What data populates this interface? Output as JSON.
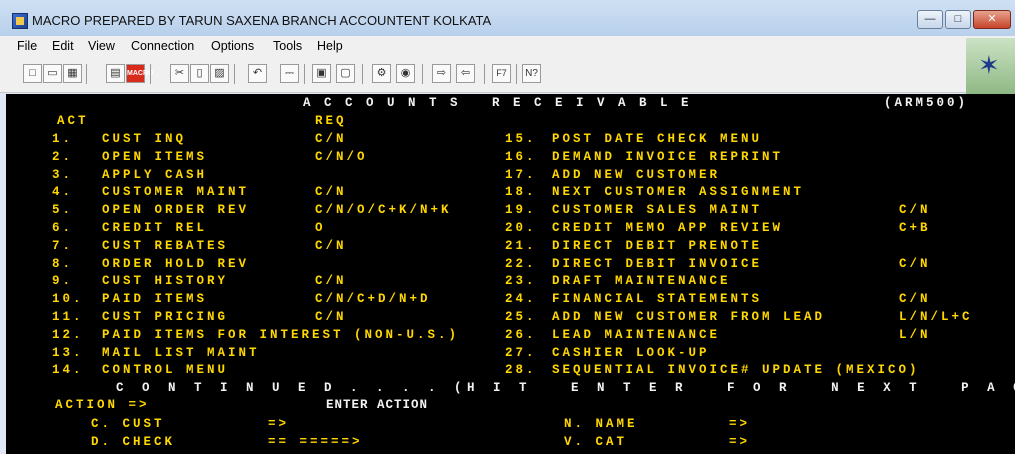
{
  "window": {
    "title": "MACRO PREPARED BY TARUN SAXENA BRANCH ACCOUNTENT KOLKATA"
  },
  "menu": [
    "File",
    "Edit",
    "View",
    "Connection",
    "Options",
    "Tools",
    "Help"
  ],
  "toolbar": {
    "items": [
      "new",
      "open",
      "save",
      "print",
      "macro",
      "cut",
      "copy",
      "paste",
      "undo",
      "transfer",
      "connect",
      "disconnect",
      "settings",
      "palette",
      "send",
      "receive",
      "F7",
      "help"
    ],
    "macro_label": "MACRO",
    "f7_label": "F7",
    "help_label": "N?"
  },
  "screen": {
    "header_title": "A C C O U N T S   R E C E I V A B L E",
    "program_code": "(ARM500)",
    "col_act": "ACT",
    "col_req": "REQ",
    "left_items": [
      {
        "num": "1.",
        "label": "CUST INQ",
        "req": "C/N"
      },
      {
        "num": "2.",
        "label": "OPEN ITEMS",
        "req": "C/N/O"
      },
      {
        "num": "3.",
        "label": "APPLY CASH",
        "req": ""
      },
      {
        "num": "4.",
        "label": "CUSTOMER MAINT",
        "req": "C/N"
      },
      {
        "num": "5.",
        "label": "OPEN ORDER REV",
        "req": "C/N/O/C+K/N+K"
      },
      {
        "num": "6.",
        "label": "CREDIT REL",
        "req": "O"
      },
      {
        "num": "7.",
        "label": "CUST REBATES",
        "req": "C/N"
      },
      {
        "num": "8.",
        "label": "ORDER HOLD REV",
        "req": ""
      },
      {
        "num": "9.",
        "label": "CUST HISTORY",
        "req": "C/N"
      },
      {
        "num": "10.",
        "label": "PAID ITEMS",
        "req": "C/N/C+D/N+D"
      },
      {
        "num": "11.",
        "label": "CUST PRICING",
        "req": "C/N"
      },
      {
        "num": "12.",
        "label": "PAID ITEMS FOR INTEREST (NON-U.S.)",
        "req": ""
      },
      {
        "num": "13.",
        "label": "MAIL LIST MAINT",
        "req": ""
      },
      {
        "num": "14.",
        "label": "CONTROL MENU",
        "req": ""
      }
    ],
    "right_items": [
      {
        "num": "15.",
        "label": "POST DATE CHECK MENU",
        "req": ""
      },
      {
        "num": "16.",
        "label": "DEMAND INVOICE REPRINT",
        "req": ""
      },
      {
        "num": "17.",
        "label": "ADD NEW CUSTOMER",
        "req": ""
      },
      {
        "num": "18.",
        "label": "NEXT CUSTOMER ASSIGNMENT",
        "req": ""
      },
      {
        "num": "19.",
        "label": "CUSTOMER SALES MAINT",
        "req": "C/N"
      },
      {
        "num": "20.",
        "label": "CREDIT MEMO APP REVIEW",
        "req": "C+B"
      },
      {
        "num": "21.",
        "label": "DIRECT DEBIT PRENOTE",
        "req": ""
      },
      {
        "num": "22.",
        "label": "DIRECT DEBIT INVOICE",
        "req": "C/N"
      },
      {
        "num": "23.",
        "label": "DRAFT MAINTENANCE",
        "req": ""
      },
      {
        "num": "24.",
        "label": "FINANCIAL STATEMENTS",
        "req": "C/N"
      },
      {
        "num": "25.",
        "label": "ADD NEW CUSTOMER FROM LEAD",
        "req": "L/N/L+C"
      },
      {
        "num": "26.",
        "label": "LEAD MAINTENANCE",
        "req": "L/N"
      },
      {
        "num": "27.",
        "label": "CASHIER LOOK-UP",
        "req": ""
      },
      {
        "num": "28.",
        "label": "SEQUENTIAL INVOICE# UPDATE (MEXICO)",
        "req": ""
      }
    ],
    "continued_line": "C O N T I N U E D . . . . (H I T   E N T E R   F O R   N E X T   P A G E)",
    "action_prompt": "ACTION =>",
    "enter_action": "ENTER ACTION",
    "fields_left": [
      {
        "label": "C. CUST",
        "value": "=>"
      },
      {
        "label": "D. CHECK",
        "value": "== =====>"
      }
    ],
    "fields_right": [
      {
        "label": "N. NAME",
        "value": "=>"
      },
      {
        "label": "V. CAT",
        "value": "=>"
      }
    ]
  }
}
